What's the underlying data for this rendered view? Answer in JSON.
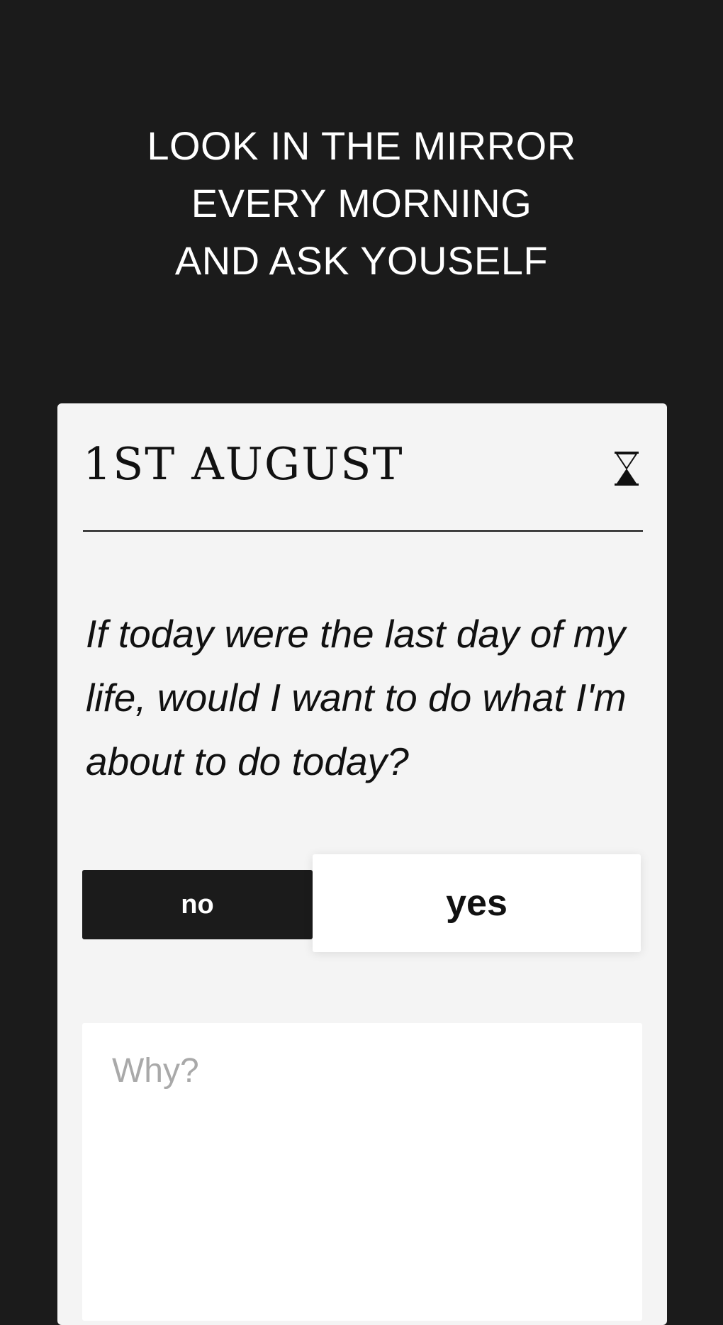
{
  "header": {
    "lines": [
      "LOOK IN THE MIRROR",
      "EVERY MORNING",
      "AND ASK YOUSELF"
    ]
  },
  "card": {
    "date": "1ST AUGUST",
    "timer_icon": "hourglass-icon",
    "question": "If today were the last day of my life, would I want to do what I'm about to do today?",
    "answers": {
      "no_label": "no",
      "yes_label": "yes",
      "selected": "yes"
    },
    "why": {
      "placeholder": "Why?",
      "value": ""
    }
  }
}
